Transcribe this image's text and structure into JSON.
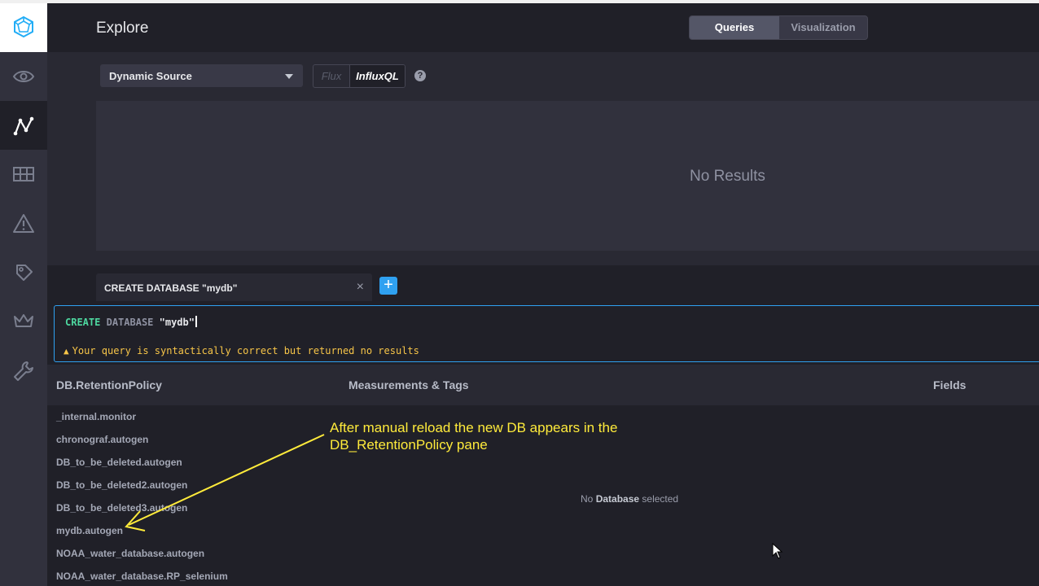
{
  "header": {
    "title": "Explore",
    "view_toggle": [
      "Queries",
      "Visualization"
    ]
  },
  "sidebar": {
    "items": [
      {
        "icon": "eye-icon",
        "active": false
      },
      {
        "icon": "graph-icon",
        "active": true
      },
      {
        "icon": "dashboard-grid-icon",
        "active": false
      },
      {
        "icon": "alert-triangle-icon",
        "active": false
      },
      {
        "icon": "wand-icon",
        "active": false
      },
      {
        "icon": "crown-icon",
        "active": false
      },
      {
        "icon": "wrench-icon",
        "active": false
      }
    ]
  },
  "source": {
    "selected": "Dynamic Source"
  },
  "language": {
    "options": [
      "Flux",
      "InfluxQL"
    ],
    "active": "InfluxQL",
    "help": "?"
  },
  "results": {
    "empty_text": "No Results"
  },
  "query_tab": {
    "label": "CREATE DATABASE \"mydb\"",
    "close": "×",
    "add": "+"
  },
  "editor": {
    "kw1": "CREATE",
    "kw2": "DATABASE",
    "string": "\"mydb\"",
    "status": "Your query is syntactically correct but returned no results"
  },
  "schema": {
    "columns": [
      "DB.RetentionPolicy",
      "Measurements & Tags",
      "Fields"
    ],
    "databases": [
      "_internal.monitor",
      "chronograf.autogen",
      "DB_to_be_deleted.autogen",
      "DB_to_be_deleted2.autogen",
      "DB_to_be_deleted3.autogen",
      "mydb.autogen",
      "NOAA_water_database.autogen",
      "NOAA_water_database.RP_selenium"
    ],
    "no_selection_pre": "No",
    "no_selection_bold": "Database",
    "no_selection_post": "selected"
  },
  "annotation": {
    "text": "After manual reload the new DB appears in the DB_RetentionPolicy pane",
    "color": "#ffeb3b"
  },
  "colors": {
    "accent": "#2fa1f1",
    "keyword": "#4ed8a0",
    "warning": "#f7c548"
  }
}
